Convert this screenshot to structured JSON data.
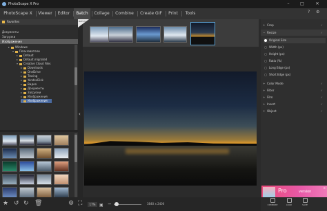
{
  "window": {
    "title": "PhotoScape X Pro"
  },
  "menu": {
    "items": [
      "PhotoScape X",
      "Viewer",
      "Editor",
      "Batch",
      "Collage",
      "Combine",
      "Create GIF",
      "Print",
      "Tools"
    ],
    "active": "Batch"
  },
  "left": {
    "favorites_label": "Favorites",
    "quick": [
      "Документы",
      "Загрузки",
      "Изображения"
    ],
    "tree": [
      "Windows",
      "Пользователи",
      "Default",
      "Default.migrated",
      "Creative Cloud Files",
      "Downloads",
      "OneDrive",
      "Tracing",
      "YandexDisk",
      "Видео",
      "Документы",
      "Загрузки",
      "Изображения",
      "Изображения"
    ]
  },
  "batch_badge": "BATCH",
  "right": {
    "sections": [
      "Crop",
      "Resize",
      "Color Mode",
      "Filter",
      "Film",
      "Insert",
      "Object"
    ],
    "resize_options": [
      "Original Size",
      "Width (px)",
      "Height (px)",
      "Ratio (%)",
      "Long Edge (px)",
      "Short Edge (px)"
    ],
    "selected_option": "Original Size"
  },
  "status": {
    "zoom": "17%",
    "dims": "3840 x 2400"
  },
  "actions": [
    "COMPARE",
    "LOAD",
    "SAVE"
  ],
  "ad": {
    "text": "Pro",
    "text2": "version"
  },
  "colors": {
    "accent": "#4a6aa0",
    "active_border": "#5aa0d0",
    "ad_pink": "#e84a7a"
  }
}
